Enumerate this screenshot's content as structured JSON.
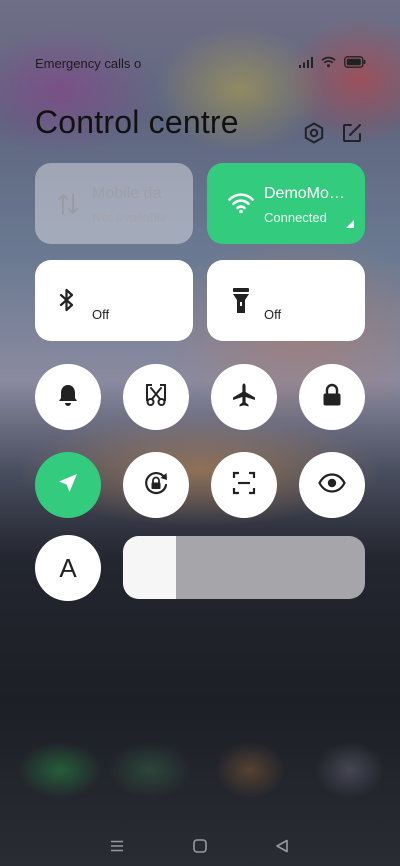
{
  "status_bar": {
    "carrier_text": "Emergency calls o",
    "icons": [
      "signal-icon",
      "wifi-icon",
      "battery-icon"
    ]
  },
  "header": {
    "title": "Control centre",
    "icons": [
      "settings-icon",
      "edit-icon"
    ]
  },
  "tiles": {
    "mobile_data": {
      "label": "Mobile da",
      "status": "Not available",
      "icon": "mobile-data-icon",
      "state": "disabled"
    },
    "wifi": {
      "label": "DemoMo…",
      "status": "Connected",
      "icon": "wifi-icon",
      "state": "on"
    },
    "bluetooth": {
      "status": "Off",
      "icon": "bluetooth-icon",
      "state": "off"
    },
    "flashlight": {
      "status": "Off",
      "icon": "flashlight-icon",
      "state": "off"
    }
  },
  "toggles": [
    {
      "name": "ring-mode",
      "icon": "bell-icon",
      "state": "off"
    },
    {
      "name": "screenshot",
      "icon": "scissors-icon",
      "state": "off"
    },
    {
      "name": "airplane-mode",
      "icon": "airplane-icon",
      "state": "off"
    },
    {
      "name": "lock-screen",
      "icon": "lock-icon",
      "state": "off"
    },
    {
      "name": "location",
      "icon": "location-arrow-icon",
      "state": "on"
    },
    {
      "name": "auto-rotate",
      "icon": "rotation-lock-icon",
      "state": "off"
    },
    {
      "name": "scan",
      "icon": "scan-icon",
      "state": "off"
    },
    {
      "name": "reading-mode",
      "icon": "eye-icon",
      "state": "off"
    }
  ],
  "auto_brightness": {
    "label": "A",
    "icon": "auto-brightness-icon"
  },
  "brightness": {
    "level": 0.22
  },
  "nav_bar": {
    "icons": [
      "menu-icon",
      "home-icon",
      "back-icon"
    ]
  },
  "colors": {
    "accent": "#33cc7f",
    "tile": "#ffffff",
    "text": "#111111"
  }
}
